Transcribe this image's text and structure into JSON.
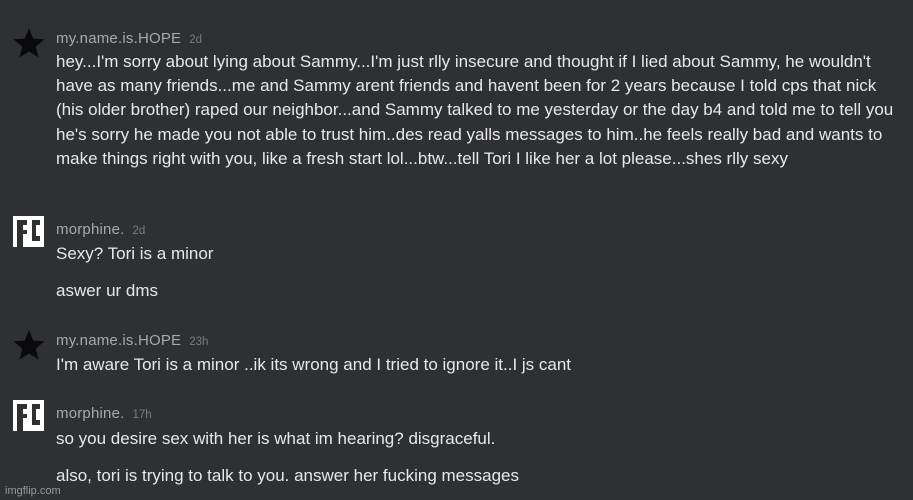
{
  "comments": [
    {
      "username": "my.name.is.HOPE",
      "time": "2d",
      "avatar_icon": "star-icon",
      "paragraphs": [
        "hey...I'm sorry about lying about Sammy...I'm just rlly insecure and thought if I lied about Sammy, he wouldn't have as many friends...me and Sammy arent friends and havent been for 2 years because I told cps that nick (his older brother) raped our neighbor...and Sammy talked to me yesterday or the day b4 and told me to tell you he's sorry he made you not able to trust him..des read yalls messages to him..he feels really bad and wants to make things right with you, like a fresh start lol...btw...tell Tori I like her a lot please...shes rlly sexy"
      ]
    },
    {
      "username": "morphine.",
      "time": "2d",
      "avatar_icon": "pixel-glyph-icon",
      "paragraphs": [
        "Sexy? Tori is a minor",
        "aswer ur dms"
      ]
    },
    {
      "username": "my.name.is.HOPE",
      "time": "23h",
      "avatar_icon": "star-icon",
      "paragraphs": [
        "I'm aware Tori is a minor ..ik its wrong and I tried to ignore it..I js cant"
      ]
    },
    {
      "username": "morphine.",
      "time": "17h",
      "avatar_icon": "pixel-glyph-icon",
      "paragraphs": [
        "so you desire sex with her is what im hearing? disgraceful.",
        "also, tori is trying to talk to you. answer her fucking messages"
      ]
    }
  ],
  "watermark": "imgflip.com",
  "colors": {
    "background": "#2f3033",
    "text": "#e8e8e8",
    "username": "#a9a9a9",
    "timestamp": "#7c7c7c"
  }
}
